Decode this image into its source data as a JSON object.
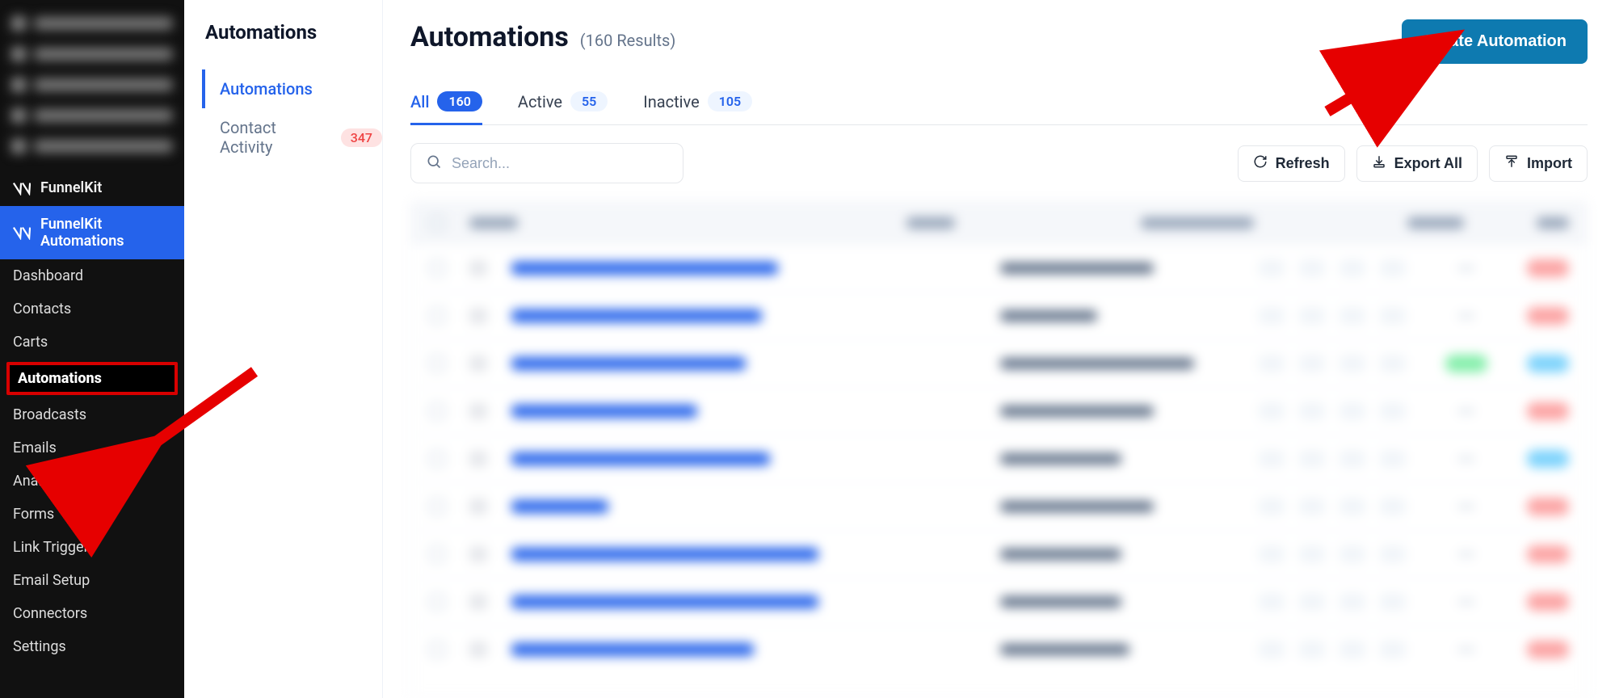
{
  "sidebar": {
    "brand_funnelkit": "FunnelKit",
    "brand_automations": "FunnelKit Automations",
    "submenu": {
      "dashboard": "Dashboard",
      "contacts": "Contacts",
      "carts": "Carts",
      "automations": "Automations",
      "broadcasts": "Broadcasts",
      "emails": "Emails",
      "analytics": "Analytics",
      "forms": "Forms",
      "link_triggers": "Link Triggers",
      "email_setup": "Email Setup",
      "connectors": "Connectors",
      "settings": "Settings"
    }
  },
  "inner": {
    "title": "Automations",
    "tabs": {
      "automations": "Automations",
      "contact_activity": "Contact Activity",
      "contact_activity_count": "347"
    }
  },
  "page": {
    "title": "Automations",
    "count": "(160 Results)",
    "create_label": "Create Automation"
  },
  "filters": {
    "all": {
      "label": "All",
      "count": "160"
    },
    "active": {
      "label": "Active",
      "count": "55"
    },
    "inactive": {
      "label": "Inactive",
      "count": "105"
    }
  },
  "search": {
    "placeholder": "Search..."
  },
  "actions": {
    "refresh": "Refresh",
    "export_all": "Export All",
    "import": "Import"
  }
}
